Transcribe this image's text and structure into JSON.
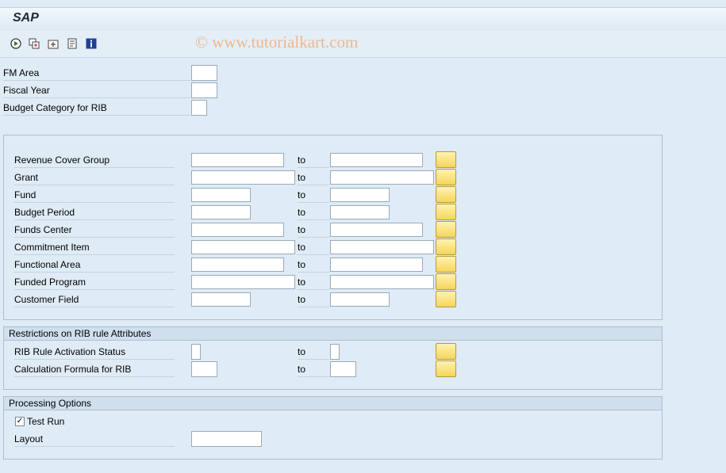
{
  "window": {
    "title": "SAP"
  },
  "watermark": "© www.tutorialkart.com",
  "toolbar": {
    "icons": [
      "execute-icon",
      "copy-variant-icon",
      "add-selection-icon",
      "notes-icon",
      "info-icon"
    ]
  },
  "top_fields": [
    {
      "label": "FM Area"
    },
    {
      "label": "Fiscal Year"
    },
    {
      "label": "Budget Category for RIB"
    }
  ],
  "range_fields": [
    {
      "label": "Revenue Cover Group",
      "to": "to"
    },
    {
      "label": "Grant",
      "to": "to"
    },
    {
      "label": "Fund",
      "to": "to"
    },
    {
      "label": "Budget Period",
      "to": "to"
    },
    {
      "label": "Funds Center",
      "to": "to"
    },
    {
      "label": "Commitment Item",
      "to": "to"
    },
    {
      "label": "Functional Area",
      "to": "to"
    },
    {
      "label": "Funded Program",
      "to": "to"
    },
    {
      "label": "Customer Field",
      "to": "to"
    }
  ],
  "restrictions": {
    "title": "Restrictions on RIB rule Attributes",
    "fields": [
      {
        "label": "RIB Rule Activation Status",
        "to": "to"
      },
      {
        "label": "Calculation Formula for RIB",
        "to": "to"
      }
    ]
  },
  "processing": {
    "title": "Processing Options",
    "test_run_label": "Test Run",
    "test_run_checked": true,
    "check_mark": "✓",
    "layout_label": "Layout"
  },
  "colors": {
    "background": "#dfebf5",
    "multi_button": "#f5d55a",
    "watermark": "#f0b585"
  }
}
